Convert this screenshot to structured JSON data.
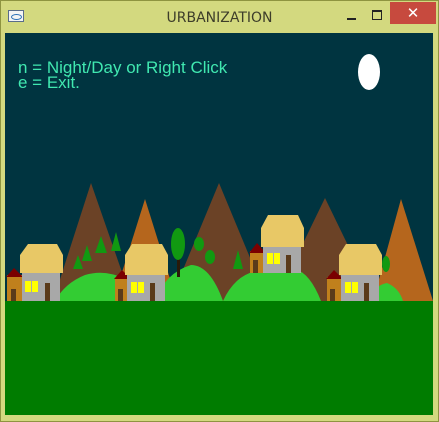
{
  "window": {
    "title": "URBANIZATION",
    "close_glyph": "✕"
  },
  "instructions": {
    "line1": "n = Night/Day or Right Click",
    "line2": "e = Exit."
  },
  "scene": {
    "mode": "night",
    "colors": {
      "sky": "#003440",
      "moon": "#ffffff",
      "text": "#40e8b0",
      "ground": "#007c00",
      "hill": "#33cc33",
      "mountain_dark": "#6b4226",
      "mountain_orange": "#b5661d",
      "roof": "#e8c866",
      "wall": "#a8a8a8",
      "window_lit": "#ffff00",
      "door": "#5a3a1a",
      "annex_roof": "#7a0000",
      "annex_wall": "#c0801c",
      "tree": "#119911"
    }
  }
}
